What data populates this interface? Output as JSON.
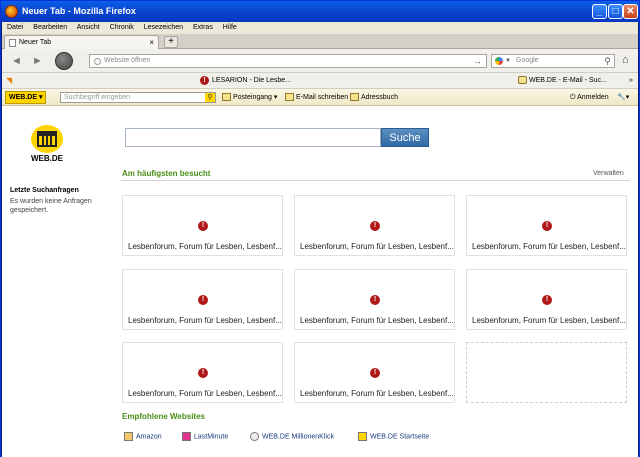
{
  "window": {
    "title": "Neuer Tab - Mozilla Firefox",
    "min": "_",
    "max": "□",
    "close": "✕"
  },
  "menu": [
    "Datei",
    "Bearbeiten",
    "Ansicht",
    "Chronik",
    "Lesezeichen",
    "Extras",
    "Hilfe"
  ],
  "tab": {
    "label": "Neuer Tab",
    "close": "×",
    "new": "+"
  },
  "nav": {
    "back": "◄",
    "forward": "►",
    "url_placeholder": "Website öffnen",
    "go": "→",
    "search_placeholder": "Google",
    "home": "⌂"
  },
  "bookmarks": [
    {
      "label": "LESARION - Die Lesbe..."
    },
    {
      "label": "WEB.DE - E-Mail - Suc..."
    }
  ],
  "bookmarks_more": "»",
  "webde_bar": {
    "logo": "WEB.DE",
    "search_placeholder": "Suchbegriff eingeben",
    "items": [
      "Posteingang",
      "E-Mail schreiben",
      "Adressbuch"
    ],
    "login": "Anmelden"
  },
  "page": {
    "logo_text": "WEB.DE",
    "search_button": "Suche",
    "most_visited": "Am häufigsten besucht",
    "manage": "Verwalten",
    "recent_title": "Letzte Suchanfragen",
    "recent_text": "Es wurden keine Anfragen gespeichert.",
    "tiles": [
      "Lesbenforum, Forum für Lesben, Lesbenf...",
      "Lesbenforum, Forum für Lesben, Lesbenf...",
      "Lesbenforum, Forum für Lesben, Lesbenf...",
      "Lesbenforum, Forum für Lesben, Lesbenf...",
      "Lesbenforum, Forum für Lesben, Lesbenf...",
      "Lesbenforum, Forum für Lesben, Lesbenf...",
      "Lesbenforum, Forum für Lesben, Lesbenf...",
      "Lesbenforum, Forum für Lesben, Lesbenf..."
    ],
    "recommended": "Empfohlene Websites",
    "recommended_sites": [
      "Amazon",
      "LastMinute",
      "WEB.DE MillionenKlick",
      "WEB.DE Startseite"
    ]
  }
}
